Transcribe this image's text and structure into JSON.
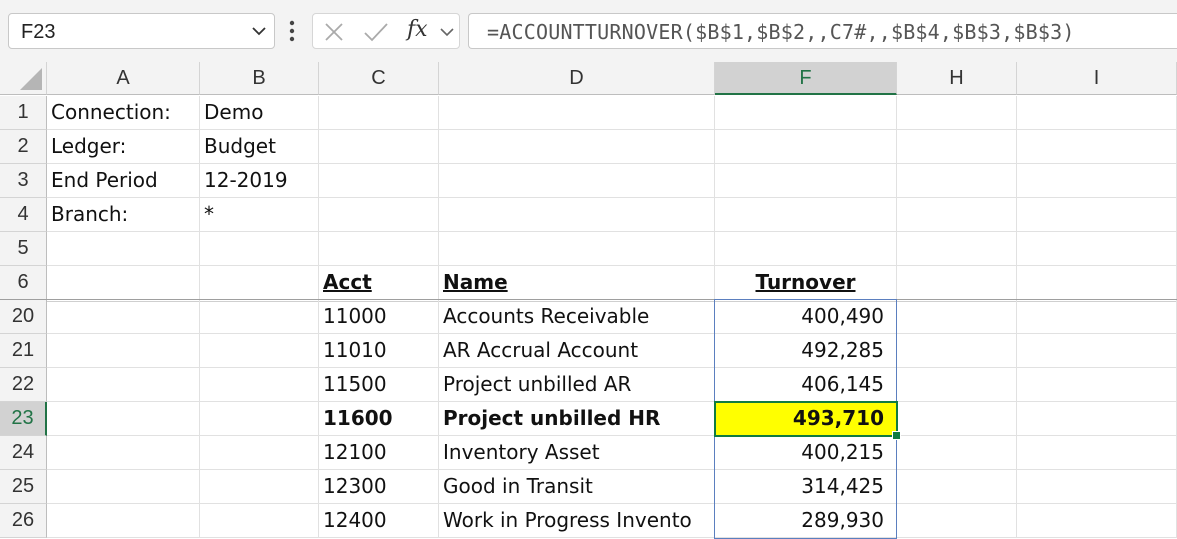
{
  "formula_bar": {
    "name_box": "F23",
    "fx_label": "fx",
    "formula": "=ACCOUNTTURNOVER($B$1,$B$2,,C7#,,$B$4,$B$3,$B$3)"
  },
  "columns": [
    "A",
    "B",
    "C",
    "D",
    "F",
    "H",
    "I"
  ],
  "selected_column": "F",
  "rows": [
    {
      "num": "1",
      "A": "Connection:",
      "B": "Demo",
      "C": "",
      "D": "",
      "F": ""
    },
    {
      "num": "2",
      "A": "Ledger:",
      "B": "Budget",
      "C": "",
      "D": "",
      "F": ""
    },
    {
      "num": "3",
      "A": "End Period",
      "B": "12-2019",
      "C": "",
      "D": "",
      "F": ""
    },
    {
      "num": "4",
      "A": "Branch:",
      "B": "*",
      "C": "",
      "D": "",
      "F": ""
    },
    {
      "num": "5",
      "A": "",
      "B": "",
      "C": "",
      "D": "",
      "F": ""
    },
    {
      "num": "6",
      "A": "",
      "B": "",
      "C": "Acct",
      "D": "Name",
      "F": "Turnover"
    },
    {
      "num": "20",
      "A": "",
      "B": "",
      "C": "11000",
      "D": "Accounts Receivable",
      "F": "400,490"
    },
    {
      "num": "21",
      "A": "",
      "B": "",
      "C": "11010",
      "D": "AR Accrual Account",
      "F": "492,285"
    },
    {
      "num": "22",
      "A": "",
      "B": "",
      "C": "11500",
      "D": "Project unbilled AR",
      "F": "406,145"
    },
    {
      "num": "23",
      "A": "",
      "B": "",
      "C": "11600",
      "D": "Project unbilled HR",
      "F": "493,710"
    },
    {
      "num": "24",
      "A": "",
      "B": "",
      "C": "12100",
      "D": "Inventory Asset",
      "F": "400,215"
    },
    {
      "num": "25",
      "A": "",
      "B": "",
      "C": "12300",
      "D": "Good in Transit",
      "F": "314,425"
    },
    {
      "num": "26",
      "A": "",
      "B": "",
      "C": "12400",
      "D": "Work in Progress Invento",
      "F": "289,930"
    }
  ],
  "active_row": "23",
  "highlight_color": "#ffff00",
  "accent_color": "#107c41"
}
